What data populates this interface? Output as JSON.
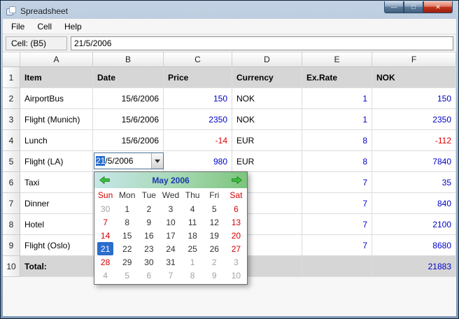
{
  "window": {
    "title": "Spreadsheet",
    "controls": {
      "minimize": "—",
      "maximize": "□",
      "close": "✕"
    }
  },
  "menu": {
    "items": [
      "File",
      "Cell",
      "Help"
    ]
  },
  "formula_bar": {
    "cell_label": "Cell: (B5)",
    "value": "21/5/2006"
  },
  "colors": {
    "value_blue": "#0000cc",
    "value_red": "#e00000",
    "selection_blue": "#2a6dcd",
    "weekend_red": "#d40000",
    "muted_gray": "#a3a3a3",
    "nav_title_blue": "#1b3ab0"
  },
  "grid": {
    "column_headers": [
      "A",
      "B",
      "C",
      "D",
      "E",
      "F"
    ],
    "rows": [
      {
        "num": "1",
        "kind": "header",
        "cells": [
          {
            "t": "Item",
            "a": "left",
            "bold": true
          },
          {
            "t": "Date",
            "a": "left",
            "bold": true
          },
          {
            "t": "Price",
            "a": "left",
            "bold": true
          },
          {
            "t": "Currency",
            "a": "left",
            "bold": true
          },
          {
            "t": "Ex.Rate",
            "a": "left",
            "bold": true
          },
          {
            "t": "NOK",
            "a": "left",
            "bold": true
          }
        ]
      },
      {
        "num": "2",
        "kind": "data",
        "cells": [
          {
            "t": "AirportBus",
            "a": "left"
          },
          {
            "t": "15/6/2006",
            "a": "right"
          },
          {
            "t": "150",
            "a": "right",
            "c": "blue"
          },
          {
            "t": "NOK",
            "a": "left"
          },
          {
            "t": "1",
            "a": "right",
            "c": "blue"
          },
          {
            "t": "150",
            "a": "right",
            "c": "blue"
          }
        ]
      },
      {
        "num": "3",
        "kind": "data",
        "cells": [
          {
            "t": "Flight (Munich)",
            "a": "left"
          },
          {
            "t": "15/6/2006",
            "a": "right"
          },
          {
            "t": "2350",
            "a": "right",
            "c": "blue"
          },
          {
            "t": "NOK",
            "a": "left"
          },
          {
            "t": "1",
            "a": "right",
            "c": "blue"
          },
          {
            "t": "2350",
            "a": "right",
            "c": "blue"
          }
        ]
      },
      {
        "num": "4",
        "kind": "data",
        "cells": [
          {
            "t": "Lunch",
            "a": "left"
          },
          {
            "t": "15/6/2006",
            "a": "right"
          },
          {
            "t": "-14",
            "a": "right",
            "c": "red"
          },
          {
            "t": "EUR",
            "a": "left"
          },
          {
            "t": "8",
            "a": "right",
            "c": "blue"
          },
          {
            "t": "-112",
            "a": "right",
            "c": "red"
          }
        ]
      },
      {
        "num": "5",
        "kind": "data",
        "cells": [
          {
            "t": "Flight (LA)",
            "a": "left"
          },
          {
            "t": "",
            "a": "right"
          },
          {
            "t": "980",
            "a": "right",
            "c": "blue"
          },
          {
            "t": "EUR",
            "a": "left"
          },
          {
            "t": "8",
            "a": "right",
            "c": "blue"
          },
          {
            "t": "7840",
            "a": "right",
            "c": "blue"
          }
        ]
      },
      {
        "num": "6",
        "kind": "data",
        "cells": [
          {
            "t": "Taxi",
            "a": "left"
          },
          {
            "t": "",
            "a": "right"
          },
          {
            "t": "",
            "a": "right"
          },
          {
            "t": "",
            "a": "left"
          },
          {
            "t": "7",
            "a": "right",
            "c": "blue"
          },
          {
            "t": "35",
            "a": "right",
            "c": "blue"
          }
        ]
      },
      {
        "num": "7",
        "kind": "data",
        "cells": [
          {
            "t": "Dinner",
            "a": "left"
          },
          {
            "t": "",
            "a": "right"
          },
          {
            "t": "",
            "a": "right"
          },
          {
            "t": "",
            "a": "left"
          },
          {
            "t": "7",
            "a": "right",
            "c": "blue"
          },
          {
            "t": "840",
            "a": "right",
            "c": "blue"
          }
        ]
      },
      {
        "num": "8",
        "kind": "data",
        "cells": [
          {
            "t": "Hotel",
            "a": "left"
          },
          {
            "t": "",
            "a": "right"
          },
          {
            "t": "",
            "a": "right"
          },
          {
            "t": "",
            "a": "left"
          },
          {
            "t": "7",
            "a": "right",
            "c": "blue"
          },
          {
            "t": "2100",
            "a": "right",
            "c": "blue"
          }
        ]
      },
      {
        "num": "9",
        "kind": "data",
        "cells": [
          {
            "t": "Flight (Oslo)",
            "a": "left"
          },
          {
            "t": "",
            "a": "right"
          },
          {
            "t": "",
            "a": "right"
          },
          {
            "t": "",
            "a": "left"
          },
          {
            "t": "7",
            "a": "right",
            "c": "blue"
          },
          {
            "t": "8680",
            "a": "right",
            "c": "blue"
          }
        ]
      },
      {
        "num": "10",
        "kind": "total",
        "cells": [
          {
            "t": "Total:",
            "a": "left",
            "bold": true
          },
          {
            "t": "",
            "a": "right"
          },
          {
            "t": "",
            "a": "right"
          },
          {
            "t": "",
            "a": "left"
          },
          {
            "t": "",
            "a": "right"
          },
          {
            "t": "21883",
            "a": "right",
            "c": "blue"
          }
        ]
      }
    ]
  },
  "date_editor": {
    "selected_text": "21",
    "rest_text": "/5/2006"
  },
  "calendar": {
    "title": "May 2006",
    "day_names": [
      "Sun",
      "Mon",
      "Tue",
      "Wed",
      "Thu",
      "Fri",
      "Sat"
    ],
    "selected_day": "21",
    "weeks": [
      [
        {
          "d": "30",
          "s": "muted"
        },
        {
          "d": "1"
        },
        {
          "d": "2"
        },
        {
          "d": "3"
        },
        {
          "d": "4"
        },
        {
          "d": "5"
        },
        {
          "d": "6",
          "s": "weekend"
        }
      ],
      [
        {
          "d": "7",
          "s": "weekend"
        },
        {
          "d": "8"
        },
        {
          "d": "9"
        },
        {
          "d": "10"
        },
        {
          "d": "11"
        },
        {
          "d": "12"
        },
        {
          "d": "13",
          "s": "weekend"
        }
      ],
      [
        {
          "d": "14",
          "s": "weekend"
        },
        {
          "d": "15"
        },
        {
          "d": "16"
        },
        {
          "d": "17"
        },
        {
          "d": "18"
        },
        {
          "d": "19"
        },
        {
          "d": "20",
          "s": "weekend"
        }
      ],
      [
        {
          "d": "21",
          "s": "selected"
        },
        {
          "d": "22"
        },
        {
          "d": "23"
        },
        {
          "d": "24"
        },
        {
          "d": "25"
        },
        {
          "d": "26"
        },
        {
          "d": "27",
          "s": "weekend"
        }
      ],
      [
        {
          "d": "28",
          "s": "weekend"
        },
        {
          "d": "29"
        },
        {
          "d": "30"
        },
        {
          "d": "31"
        },
        {
          "d": "1",
          "s": "muted"
        },
        {
          "d": "2",
          "s": "muted"
        },
        {
          "d": "3",
          "s": "muted"
        }
      ],
      [
        {
          "d": "4",
          "s": "muted"
        },
        {
          "d": "5",
          "s": "muted"
        },
        {
          "d": "6",
          "s": "muted"
        },
        {
          "d": "7",
          "s": "muted"
        },
        {
          "d": "8",
          "s": "muted"
        },
        {
          "d": "9",
          "s": "muted"
        },
        {
          "d": "10",
          "s": "muted"
        }
      ]
    ]
  }
}
